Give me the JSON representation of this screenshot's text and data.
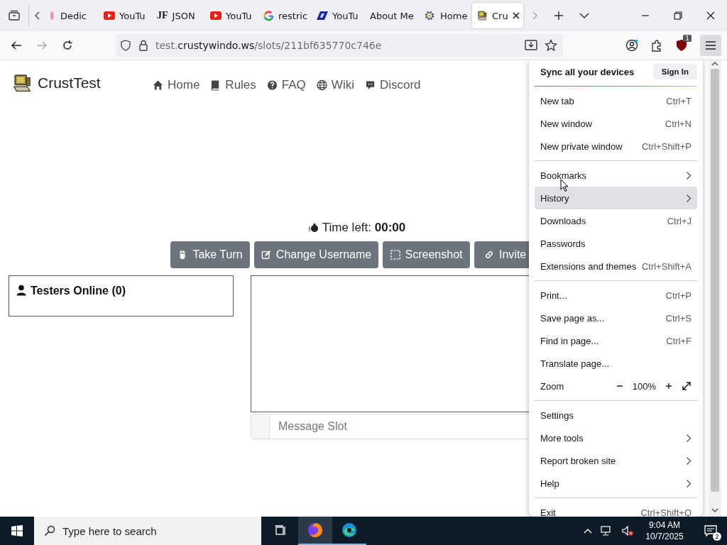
{
  "tabs": [
    {
      "title": "Dedic",
      "kind": "dot",
      "selected": false
    },
    {
      "title": "YouTu",
      "kind": "youtube",
      "selected": false
    },
    {
      "title": "JSON",
      "kind": "text",
      "icon_text": "JF",
      "selected": false
    },
    {
      "title": "YouTu",
      "kind": "youtube",
      "selected": false
    },
    {
      "title": "restric",
      "kind": "google",
      "selected": false
    },
    {
      "title": "YouTu",
      "kind": "slant",
      "selected": false
    },
    {
      "title": "About Me",
      "kind": "plain",
      "selected": false
    },
    {
      "title": "Home",
      "kind": "gear",
      "selected": false
    },
    {
      "title": "Cru",
      "kind": "computer",
      "selected": true
    }
  ],
  "address": {
    "prefix": "test.",
    "domain": "crustywindo.ws",
    "path": "/slots/211bf635770c746e"
  },
  "extension_badge": "1",
  "site": {
    "name": "CrustTest",
    "nav": [
      {
        "label": "Home",
        "kind": "home"
      },
      {
        "label": "Rules",
        "kind": "book"
      },
      {
        "label": "FAQ",
        "kind": "question"
      },
      {
        "label": "Wiki",
        "kind": "globe"
      },
      {
        "label": "Discord",
        "kind": "chat"
      }
    ],
    "timer": "Time left: **00:00**",
    "actions": [
      {
        "label": "Take Turn",
        "kind": "mouse"
      },
      {
        "label": "Change Username",
        "kind": "edit"
      },
      {
        "label": "Screenshot",
        "kind": "selection"
      },
      {
        "label": "Invite",
        "kind": "link"
      }
    ],
    "testers_title": "Testers Online (0)",
    "message_field": {
      "placeholder": "Message Slot"
    }
  },
  "menu": {
    "sync_label": "Sync all your devices",
    "sign_in": "Sign In",
    "sections": [
      [
        {
          "label": "New tab",
          "shortcut": "Ctrl+T",
          "kind": "shortcut",
          "hovered": false
        },
        {
          "label": "New window",
          "shortcut": "Ctrl+N",
          "kind": "shortcut",
          "hovered": false
        },
        {
          "label": "New private window",
          "shortcut": "Ctrl+Shift+P",
          "kind": "shortcut",
          "hovered": false
        }
      ],
      [
        {
          "label": "Bookmarks",
          "kind": "submenu",
          "hovered": false
        },
        {
          "label": "History",
          "kind": "submenu",
          "hovered": true
        },
        {
          "label": "Downloads",
          "shortcut": "Ctrl+J",
          "kind": "shortcut",
          "hovered": false
        },
        {
          "label": "Passwords",
          "kind": "plain",
          "hovered": false
        },
        {
          "label": "Extensions and themes",
          "shortcut": "Ctrl+Shift+A",
          "kind": "shortcut",
          "hovered": false
        }
      ],
      [
        {
          "label": "Print...",
          "shortcut": "Ctrl+P",
          "kind": "shortcut",
          "hovered": false
        },
        {
          "label": "Save page as...",
          "shortcut": "Ctrl+S",
          "kind": "shortcut",
          "hovered": false
        },
        {
          "label": "Find in page...",
          "shortcut": "Ctrl+F",
          "kind": "shortcut",
          "hovered": false
        },
        {
          "label": "Translate page...",
          "kind": "plain",
          "hovered": false
        },
        {
          "label": "Zoom",
          "kind": "zoom",
          "zoom_text": "100%",
          "hovered": false
        }
      ],
      [
        {
          "label": "Settings",
          "kind": "plain",
          "hovered": false
        },
        {
          "label": "More tools",
          "kind": "submenu",
          "hovered": false
        },
        {
          "label": "Report broken site",
          "kind": "submenu",
          "hovered": false
        },
        {
          "label": "Help",
          "kind": "submenu",
          "hovered": false
        }
      ],
      [
        {
          "label": "Exit",
          "shortcut": "Ctrl+Shift+Q",
          "kind": "shortcut",
          "hovered": false
        }
      ]
    ]
  },
  "taskbar": {
    "search_placeholder": "Type here to search",
    "time": "9:04 AM",
    "date": "10/7/2025",
    "notification_count": "2"
  }
}
